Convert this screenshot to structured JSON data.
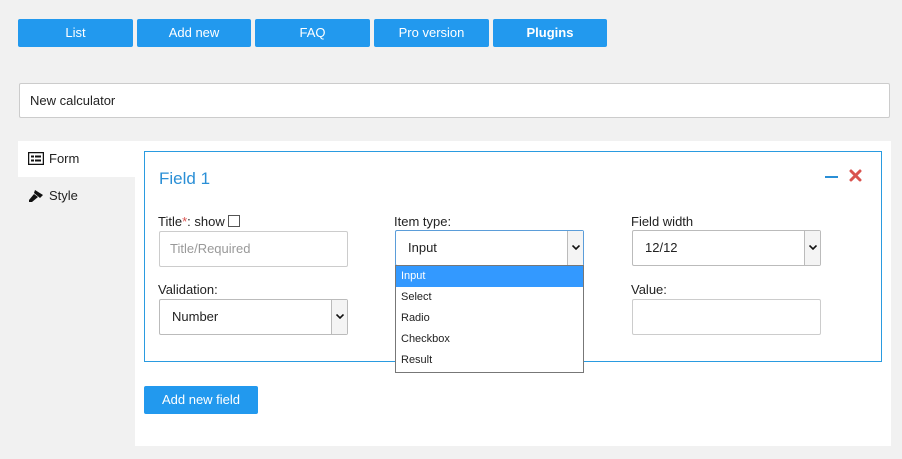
{
  "nav": {
    "list": "List",
    "add_new": "Add new",
    "faq": "FAQ",
    "pro": "Pro version",
    "plugins": "Plugins"
  },
  "calculator_name": "New calculator",
  "tabs": {
    "form": "Form",
    "style": "Style"
  },
  "field": {
    "title": "Field 1",
    "title_label": "Title",
    "title_required_mark": "*",
    "title_show": ": show",
    "title_placeholder": "Title/Required",
    "item_type_label": "Item type:",
    "item_type_value": "Input",
    "field_width_label": "Field width",
    "field_width_value": "12/12",
    "validation_label": "Validation:",
    "validation_value": "Number",
    "value_label": "Value:",
    "value_value": ""
  },
  "item_type_options": [
    "Input",
    "Select",
    "Radio",
    "Checkbox",
    "Result"
  ],
  "add_field_label": "Add new field",
  "colors": {
    "accent": "#2299ee",
    "dropdown_selected": "#3399ff",
    "remove": "#d9534f"
  }
}
